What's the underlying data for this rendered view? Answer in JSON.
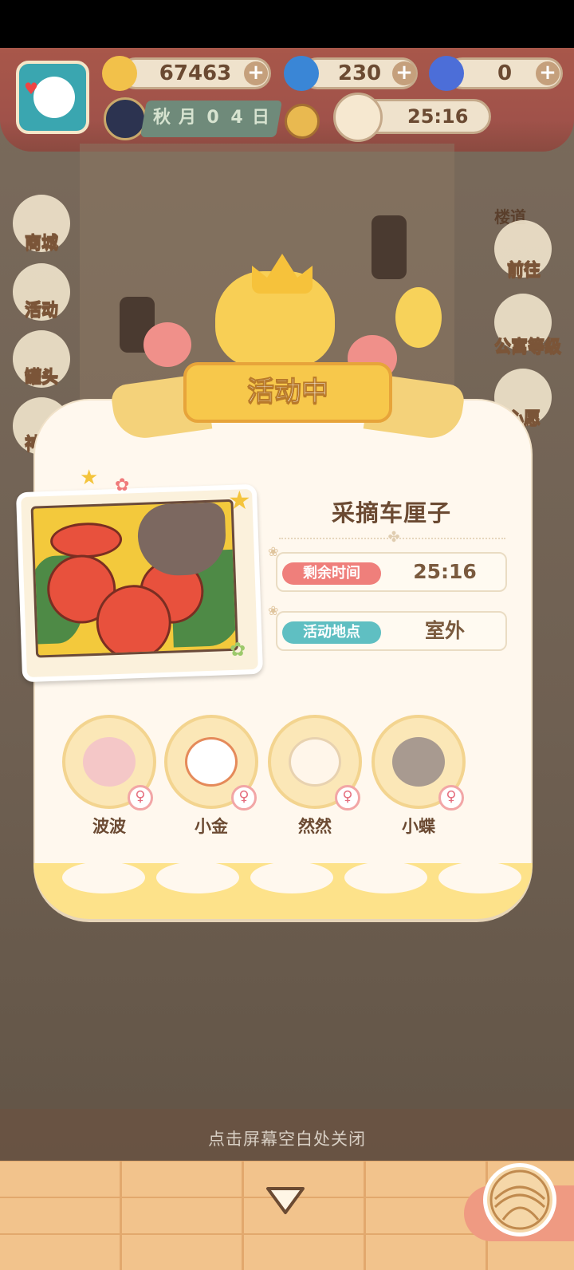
{
  "currencies": {
    "banana": {
      "value": "67463",
      "icon": "banana-icon"
    },
    "flame": {
      "value": "230",
      "icon": "blue-flame-icon"
    },
    "blue_banana": {
      "value": "0",
      "icon": "blue-banana-icon"
    }
  },
  "date": {
    "season": "秋",
    "month": "月",
    "d1": "0",
    "d2": "4",
    "day": "日"
  },
  "top_timer": "25:16",
  "side_left": [
    {
      "label": "商城",
      "icon": "shop-icon"
    },
    {
      "label": "活动",
      "icon": "gift-icon"
    },
    {
      "label": "罐头",
      "icon": "can-icon"
    },
    {
      "label": "神灯",
      "icon": "lamp-icon"
    }
  ],
  "side_right": [
    {
      "label": "前往",
      "icon": "map-pin-icon"
    },
    {
      "label": "公寓等级",
      "icon": "apartment-level-icon"
    },
    {
      "label": "心愿",
      "icon": "wish-book-icon"
    }
  ],
  "bg_sign": "楼道",
  "modal": {
    "banner": "活动中",
    "event_title": "采摘车厘子",
    "rows": [
      {
        "tag": "剩余时间",
        "value": "25:16",
        "tag_color": "#ef7f7b"
      },
      {
        "tag": "活动地点",
        "value": "室外",
        "tag_color": "#5fbfc2"
      }
    ],
    "characters": [
      {
        "name": "波波",
        "face": "#f4c7c7"
      },
      {
        "name": "小金",
        "face": "#ffffff"
      },
      {
        "name": "然然",
        "face": "#fff6ea"
      },
      {
        "name": "小蝶",
        "face": "#a89a90"
      }
    ],
    "gender_symbol": "♀"
  },
  "close_hint": "点击屏幕空白处关闭",
  "colors": {
    "accent": "#f7c84b",
    "brown": "#6b4a32",
    "cream": "#fff8ee"
  }
}
